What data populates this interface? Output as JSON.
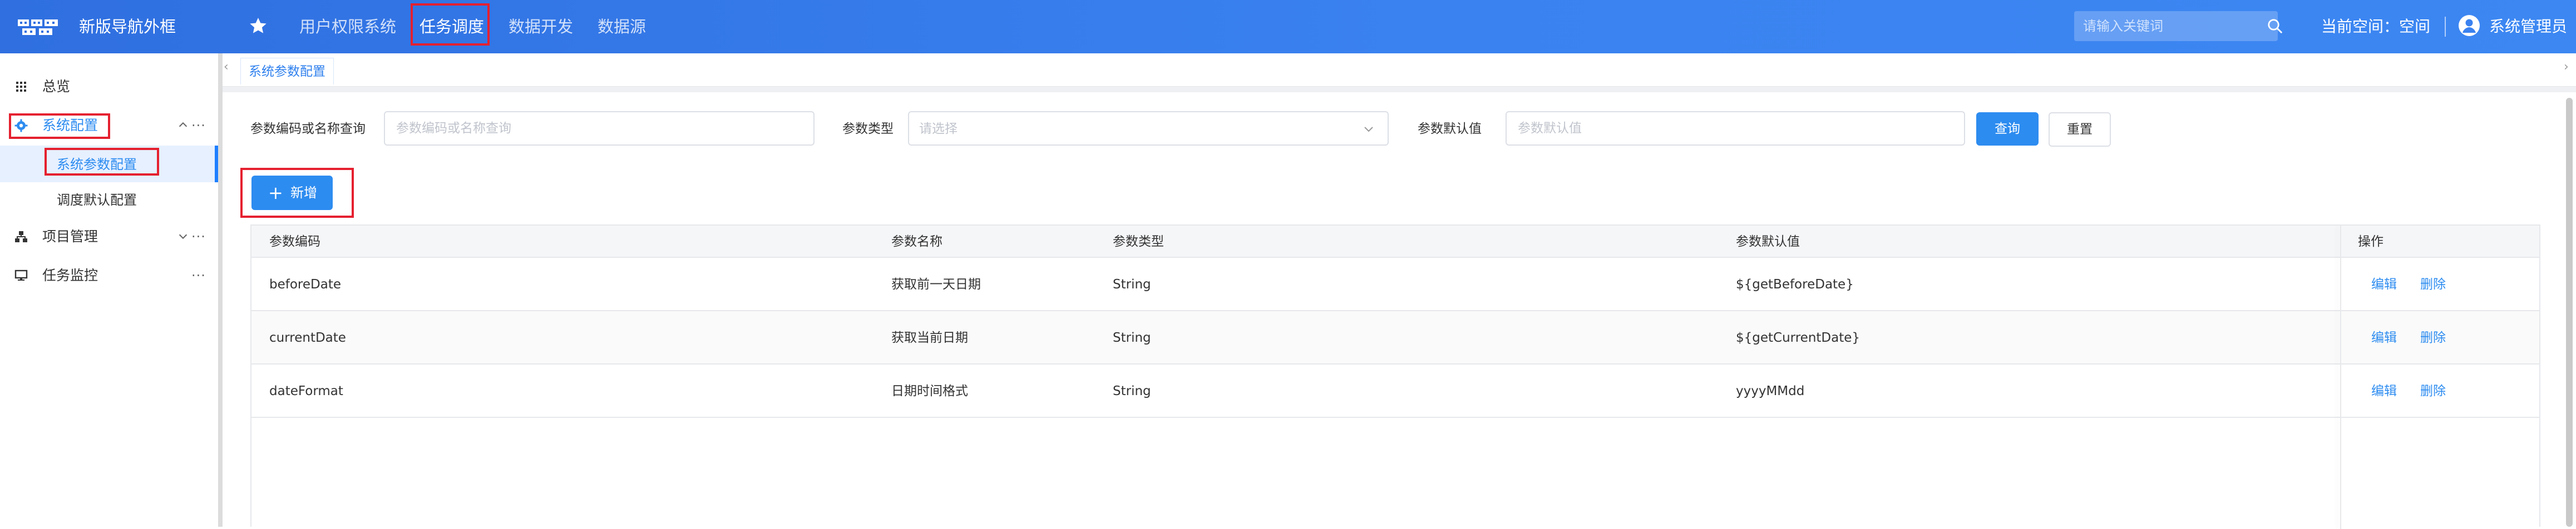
{
  "header": {
    "app_title": "新版导航外框",
    "nav": [
      "用户权限系统",
      "任务调度",
      "数据开发",
      "数据源"
    ],
    "active_nav_index": 1,
    "search_placeholder": "请输入关键词",
    "current_space": "当前空间：空间",
    "user_name": "系统管理员",
    "icons": {
      "logo": "app-logo",
      "favorite": "star-icon",
      "search": "search-icon",
      "user": "user-avatar-icon"
    }
  },
  "sidebar": {
    "items": [
      {
        "label": "总览",
        "icon": "grid-icon"
      },
      {
        "label": "系统配置",
        "icon": "gear-icon",
        "expanded": true,
        "children": [
          "系统参数配置",
          "调度默认配置"
        ],
        "selected_child": 0
      },
      {
        "label": "项目管理",
        "icon": "sitemap-icon",
        "expanded": false
      },
      {
        "label": "任务监控",
        "icon": "monitor-icon"
      }
    ],
    "more_glyph": "···"
  },
  "tabs": {
    "active_label": "系统参数配置"
  },
  "filters": {
    "code_label": "参数编码或名称查询",
    "code_placeholder": "参数编码或名称查询",
    "type_label": "参数类型",
    "type_placeholder": "请选择",
    "default_label": "参数默认值",
    "default_placeholder": "参数默认值",
    "query_button": "查询",
    "reset_button": "重置"
  },
  "toolbar": {
    "add_button": "新增"
  },
  "table": {
    "columns": [
      "参数编码",
      "参数名称",
      "参数类型",
      "参数默认值",
      "操作"
    ],
    "rows": [
      {
        "code": "beforeDate",
        "name": "获取前一天日期",
        "type": "String",
        "default": "${getBeforeDate}",
        "edit": "编辑",
        "delete": "删除"
      },
      {
        "code": "currentDate",
        "name": "获取当前日期",
        "type": "String",
        "default": "${getCurrentDate}",
        "edit": "编辑",
        "delete": "删除"
      },
      {
        "code": "dateFormat",
        "name": "日期时间格式",
        "type": "String",
        "default": "yyyyMMdd",
        "edit": "编辑",
        "delete": "删除"
      }
    ]
  },
  "colors": {
    "header_blue": "#3a82f0",
    "accent": "#2d8cf0",
    "highlight_red": "#e5202f"
  }
}
